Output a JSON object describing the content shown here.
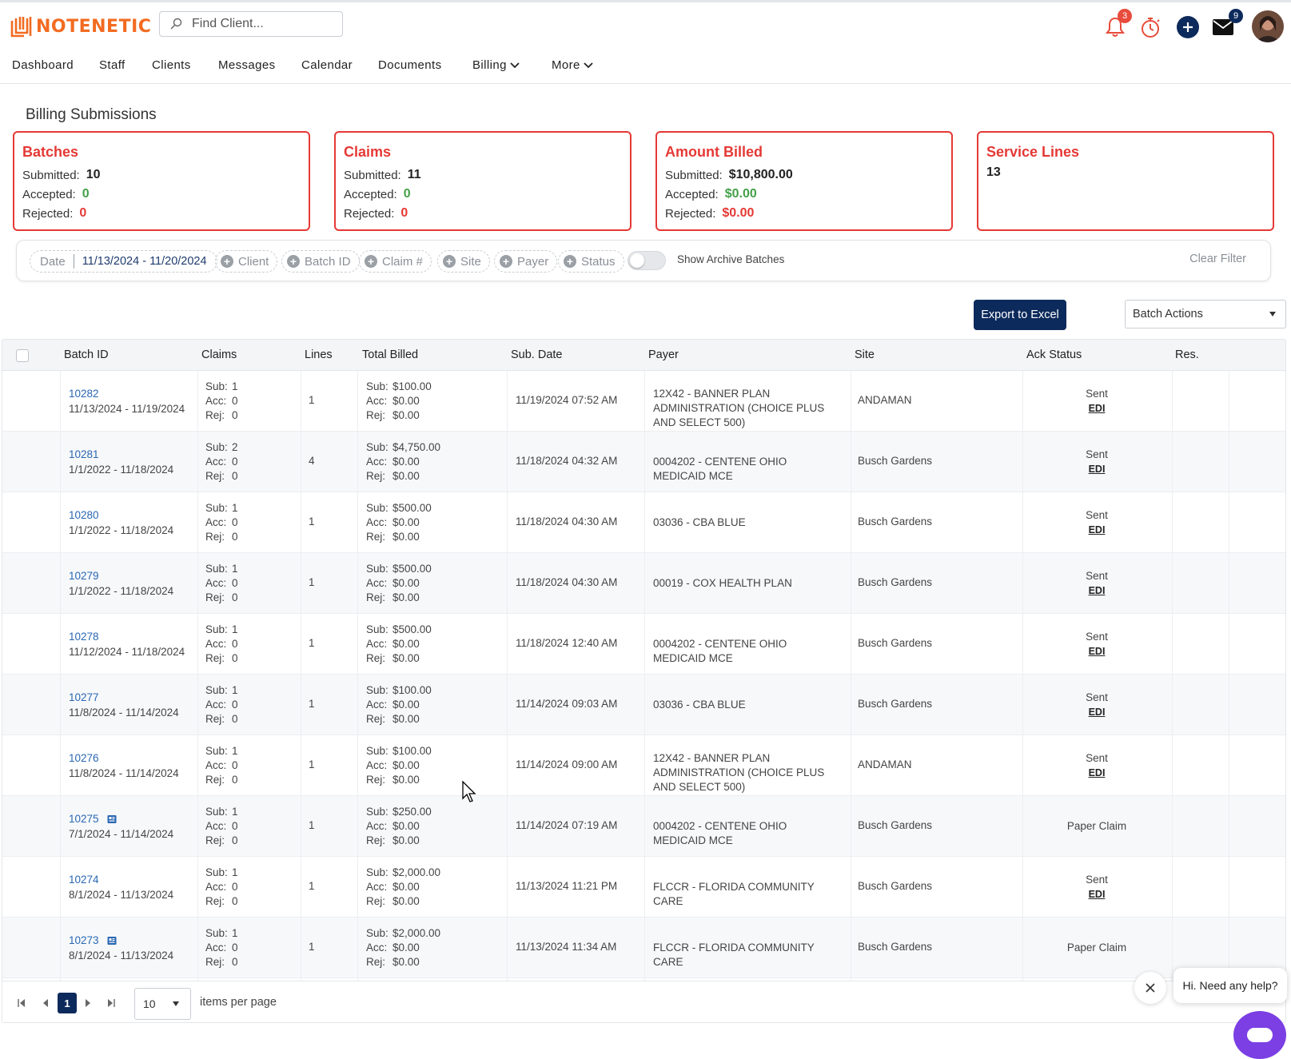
{
  "app": {
    "brand": "NOTENETIC",
    "search_placeholder": "Find Client...",
    "notifications_count": "3",
    "messages_count": "9",
    "brand_color": "#f26b21",
    "accent_color": "#0d2a5c",
    "alert_color": "#e53935"
  },
  "nav": {
    "items": [
      "Dashboard",
      "Staff",
      "Clients",
      "Messages",
      "Calendar",
      "Documents",
      "Billing",
      "More"
    ]
  },
  "page": {
    "title": "Billing Submissions"
  },
  "summary": {
    "batches": {
      "title": "Batches",
      "submitted_label": "Submitted:",
      "submitted": "10",
      "accepted_label": "Accepted:",
      "accepted": "0",
      "rejected_label": "Rejected:",
      "rejected": "0"
    },
    "claims": {
      "title": "Claims",
      "submitted_label": "Submitted:",
      "submitted": "11",
      "accepted_label": "Accepted:",
      "accepted": "0",
      "rejected_label": "Rejected:",
      "rejected": "0"
    },
    "amount": {
      "title": "Amount Billed",
      "submitted_label": "Submitted:",
      "submitted": "$10,800.00",
      "accepted_label": "Accepted:",
      "accepted": "$0.00",
      "rejected_label": "Rejected:",
      "rejected": "$0.00"
    },
    "service_lines": {
      "title": "Service Lines",
      "value": "13"
    }
  },
  "filters": {
    "date_label": "Date",
    "date_value": "11/13/2024 - 11/20/2024",
    "chips": [
      "Client",
      "Batch ID",
      "Claim #",
      "Site",
      "Payer",
      "Status"
    ],
    "archive_toggle_label": "Show Archive Batches",
    "archive_toggle_on": false,
    "clear_label": "Clear Filter"
  },
  "actions": {
    "export_label": "Export to Excel",
    "batch_actions_label": "Batch Actions"
  },
  "table": {
    "columns": [
      "Batch ID",
      "Claims",
      "Lines",
      "Total Billed",
      "Sub. Date",
      "Payer",
      "Site",
      "Ack Status",
      "Res."
    ],
    "mini_labels": {
      "sub": "Sub:",
      "acc": "Acc:",
      "rej": "Rej:"
    },
    "rows": [
      {
        "id": "10282",
        "range": "11/13/2024 - 11/19/2024",
        "paper": false,
        "claims_sub": "1",
        "claims_acc": "0",
        "claims_rej": "0",
        "lines": "1",
        "billed_sub": "$100.00",
        "billed_acc": "$0.00",
        "billed_rej": "$0.00",
        "sub_date": "11/19/2024 07:52 AM",
        "payer": "12X42 - BANNER PLAN ADMINISTRATION (CHOICE PLUS AND SELECT 500)",
        "site": "ANDAMAN",
        "ack": "Sent",
        "edi": "EDI"
      },
      {
        "id": "10281",
        "range": "1/1/2022 - 11/18/2024",
        "paper": false,
        "claims_sub": "2",
        "claims_acc": "0",
        "claims_rej": "0",
        "lines": "4",
        "billed_sub": "$4,750.00",
        "billed_acc": "$0.00",
        "billed_rej": "$0.00",
        "sub_date": "11/18/2024 04:32 AM",
        "payer": "0004202 - CENTENE OHIO MEDICAID MCE",
        "site": "Busch Gardens",
        "ack": "Sent",
        "edi": "EDI"
      },
      {
        "id": "10280",
        "range": "1/1/2022 - 11/18/2024",
        "paper": false,
        "claims_sub": "1",
        "claims_acc": "0",
        "claims_rej": "0",
        "lines": "1",
        "billed_sub": "$500.00",
        "billed_acc": "$0.00",
        "billed_rej": "$0.00",
        "sub_date": "11/18/2024 04:30 AM",
        "payer": "03036 - CBA BLUE",
        "site": "Busch Gardens",
        "ack": "Sent",
        "edi": "EDI"
      },
      {
        "id": "10279",
        "range": "1/1/2022 - 11/18/2024",
        "paper": false,
        "claims_sub": "1",
        "claims_acc": "0",
        "claims_rej": "0",
        "lines": "1",
        "billed_sub": "$500.00",
        "billed_acc": "$0.00",
        "billed_rej": "$0.00",
        "sub_date": "11/18/2024 04:30 AM",
        "payer": "00019 - COX HEALTH PLAN",
        "site": "Busch Gardens",
        "ack": "Sent",
        "edi": "EDI"
      },
      {
        "id": "10278",
        "range": "11/12/2024 - 11/18/2024",
        "paper": false,
        "claims_sub": "1",
        "claims_acc": "0",
        "claims_rej": "0",
        "lines": "1",
        "billed_sub": "$500.00",
        "billed_acc": "$0.00",
        "billed_rej": "$0.00",
        "sub_date": "11/18/2024 12:40 AM",
        "payer": "0004202 - CENTENE OHIO MEDICAID MCE",
        "site": "Busch Gardens",
        "ack": "Sent",
        "edi": "EDI"
      },
      {
        "id": "10277",
        "range": "11/8/2024 - 11/14/2024",
        "paper": false,
        "claims_sub": "1",
        "claims_acc": "0",
        "claims_rej": "0",
        "lines": "1",
        "billed_sub": "$100.00",
        "billed_acc": "$0.00",
        "billed_rej": "$0.00",
        "sub_date": "11/14/2024 09:03 AM",
        "payer": "03036 - CBA BLUE",
        "site": "Busch Gardens",
        "ack": "Sent",
        "edi": "EDI"
      },
      {
        "id": "10276",
        "range": "11/8/2024 - 11/14/2024",
        "paper": false,
        "claims_sub": "1",
        "claims_acc": "0",
        "claims_rej": "0",
        "lines": "1",
        "billed_sub": "$100.00",
        "billed_acc": "$0.00",
        "billed_rej": "$0.00",
        "sub_date": "11/14/2024 09:00 AM",
        "payer": "12X42 - BANNER PLAN ADMINISTRATION (CHOICE PLUS AND SELECT 500)",
        "site": "ANDAMAN",
        "ack": "Sent",
        "edi": "EDI"
      },
      {
        "id": "10275",
        "range": "7/1/2024 - 11/14/2024",
        "paper": true,
        "claims_sub": "1",
        "claims_acc": "0",
        "claims_rej": "0",
        "lines": "1",
        "billed_sub": "$250.00",
        "billed_acc": "$0.00",
        "billed_rej": "$0.00",
        "sub_date": "11/14/2024 07:19 AM",
        "payer": "0004202 - CENTENE OHIO MEDICAID MCE",
        "site": "Busch Gardens",
        "ack": "Paper Claim",
        "edi": ""
      },
      {
        "id": "10274",
        "range": "8/1/2024 - 11/13/2024",
        "paper": false,
        "claims_sub": "1",
        "claims_acc": "0",
        "claims_rej": "0",
        "lines": "1",
        "billed_sub": "$2,000.00",
        "billed_acc": "$0.00",
        "billed_rej": "$0.00",
        "sub_date": "11/13/2024 11:21 PM",
        "payer": "FLCCR - FLORIDA COMMUNITY CARE",
        "site": "Busch Gardens",
        "ack": "Sent",
        "edi": "EDI"
      },
      {
        "id": "10273",
        "range": "8/1/2024 - 11/13/2024",
        "paper": true,
        "claims_sub": "1",
        "claims_acc": "0",
        "claims_rej": "0",
        "lines": "1",
        "billed_sub": "$2,000.00",
        "billed_acc": "$0.00",
        "billed_rej": "$0.00",
        "sub_date": "11/13/2024 11:34 AM",
        "payer": "FLCCR - FLORIDA COMMUNITY CARE",
        "site": "Busch Gardens",
        "ack": "Paper Claim",
        "edi": ""
      }
    ]
  },
  "pager": {
    "current_page": "1",
    "page_size": "10",
    "items_per_page_label": "items per page"
  },
  "chat": {
    "greeting": "Hi. Need any help?"
  }
}
